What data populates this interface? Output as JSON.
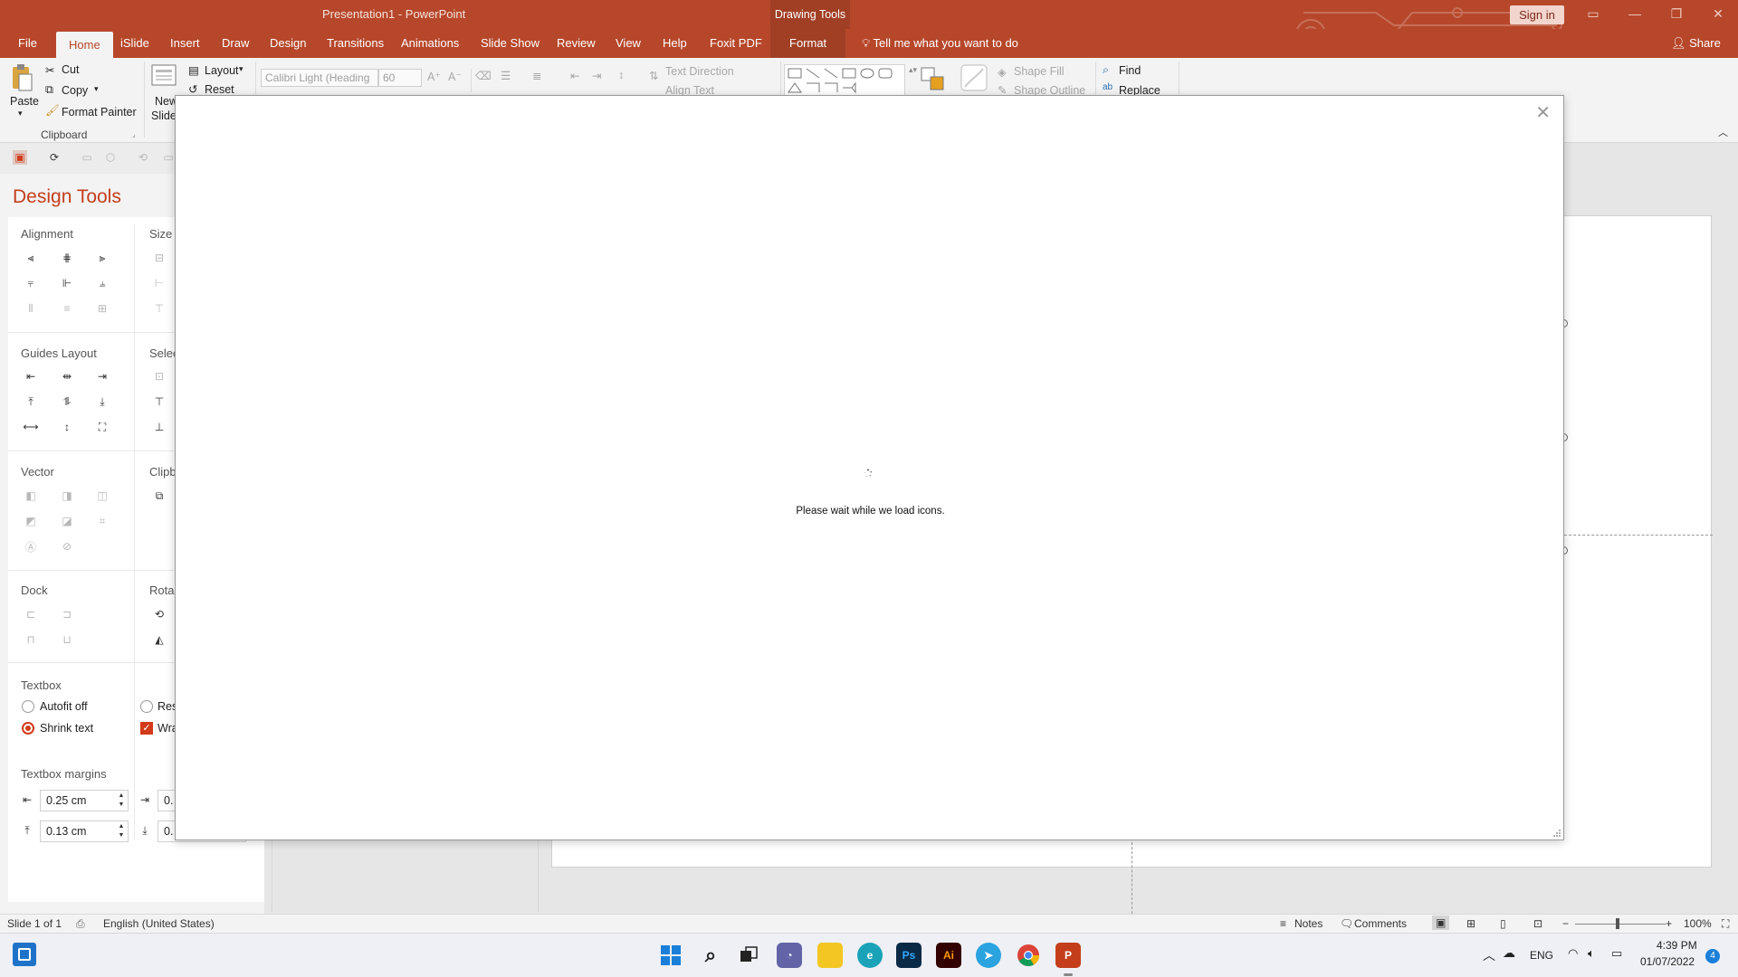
{
  "window": {
    "title": "Presentation1 - PowerPoint",
    "context_tools": "Drawing Tools",
    "sign_in": "Sign in",
    "accent": "#b7472a"
  },
  "tabs": {
    "file": "File",
    "home": "Home",
    "islide": "iSlide",
    "insert": "Insert",
    "draw": "Draw",
    "design": "Design",
    "transitions": "Transitions",
    "animations": "Animations",
    "slideshow": "Slide Show",
    "review": "Review",
    "view": "View",
    "help": "Help",
    "foxit": "Foxit PDF",
    "format": "Format",
    "tell_me": "Tell me what you want to do",
    "share": "Share"
  },
  "ribbon": {
    "paste": "Paste",
    "cut": "Cut",
    "copy": "Copy",
    "format_painter": "Format Painter",
    "clipboard_group": "Clipboard",
    "new_slide_1": "New",
    "new_slide_2": "Slide",
    "layout": "Layout",
    "reset": "Reset",
    "font_name": "Calibri Light (Heading",
    "font_size": "60",
    "text_direction": "Text Direction",
    "align_text": "Align Text",
    "shape_fill": "Shape Fill",
    "shape_outline": "Shape Outline",
    "find": "Find",
    "replace": "Replace"
  },
  "design_tools": {
    "title": "Design Tools",
    "alignment": "Alignment",
    "size": "Size",
    "guides_layout": "Guides Layout",
    "select": "Selec",
    "vector": "Vector",
    "clipboard": "Clipb",
    "dock": "Dock",
    "rotate": "Rota",
    "textbox": "Textbox",
    "autofit_off": "Autofit off",
    "shrink_text": "Shrink text",
    "resize_partial": "Res",
    "wrap_partial": "Wra",
    "textbox_margins": "Textbox margins",
    "margin_left": "0.25 cm",
    "margin_right_partial": "0.",
    "margin_top": "0.13 cm",
    "margin_bottom_partial": "0."
  },
  "dialog": {
    "loading_text": "Please wait while we load icons."
  },
  "statusbar": {
    "slide_count": "Slide 1 of 1",
    "language": "English (United States)",
    "notes": "Notes",
    "comments": "Comments",
    "zoom": "100%"
  },
  "taskbar": {
    "lang": "ENG",
    "time": "4:39 PM",
    "date": "01/07/2022",
    "notification_count": "4",
    "ps": "Ps",
    "ai": "Ai"
  }
}
